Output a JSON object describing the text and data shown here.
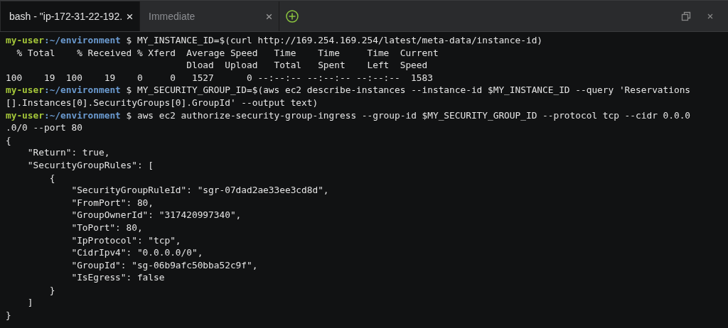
{
  "tabs": [
    {
      "label": "bash - \"ip-172-31-22-192.",
      "selected": true
    },
    {
      "label": "Immediate",
      "selected": false
    }
  ],
  "terminal": {
    "lines": [
      {
        "kind": "prompt",
        "user": "my-user",
        "path": ":~/environment",
        "command": " $ MY_INSTANCE_ID=$(curl http://169.254.169.254/latest/meta-data/instance-id)"
      },
      {
        "kind": "output",
        "text": "  % Total    % Received % Xferd  Average Speed   Time    Time     Time  Current"
      },
      {
        "kind": "output",
        "text": "                                 Dload  Upload   Total   Spent    Left  Speed"
      },
      {
        "kind": "output",
        "text": "100    19  100    19    0     0   1527      0 --:--:-- --:--:-- --:--:--  1583"
      },
      {
        "kind": "prompt",
        "user": "my-user",
        "path": ":~/environment",
        "command": " $ MY_SECURITY_GROUP_ID=$(aws ec2 describe-instances --instance-id $MY_INSTANCE_ID --query 'Reservations"
      },
      {
        "kind": "output",
        "text": "[].Instances[0].SecurityGroups[0].GroupId' --output text)"
      },
      {
        "kind": "prompt",
        "user": "my-user",
        "path": ":~/environment",
        "command": " $ aws ec2 authorize-security-group-ingress --group-id $MY_SECURITY_GROUP_ID --protocol tcp --cidr 0.0.0"
      },
      {
        "kind": "output",
        "text": ".0/0 --port 80"
      },
      {
        "kind": "output",
        "text": "{"
      },
      {
        "kind": "output",
        "text": "    \"Return\": true,"
      },
      {
        "kind": "output",
        "text": "    \"SecurityGroupRules\": ["
      },
      {
        "kind": "output",
        "text": "        {"
      },
      {
        "kind": "output",
        "text": "            \"SecurityGroupRuleId\": \"sgr-07dad2ae33ee3cd8d\","
      },
      {
        "kind": "output",
        "text": "            \"FromPort\": 80,"
      },
      {
        "kind": "output",
        "text": "            \"GroupOwnerId\": \"317420997340\","
      },
      {
        "kind": "output",
        "text": "            \"ToPort\": 80,"
      },
      {
        "kind": "output",
        "text": "            \"IpProtocol\": \"tcp\","
      },
      {
        "kind": "output",
        "text": "            \"CidrIpv4\": \"0.0.0.0/0\","
      },
      {
        "kind": "output",
        "text": "            \"GroupId\": \"sg-06b9afc50bba52c9f\","
      },
      {
        "kind": "output",
        "text": "            \"IsEgress\": false"
      },
      {
        "kind": "output",
        "text": "        }"
      },
      {
        "kind": "output",
        "text": "    ]"
      },
      {
        "kind": "output",
        "text": "}"
      }
    ]
  }
}
